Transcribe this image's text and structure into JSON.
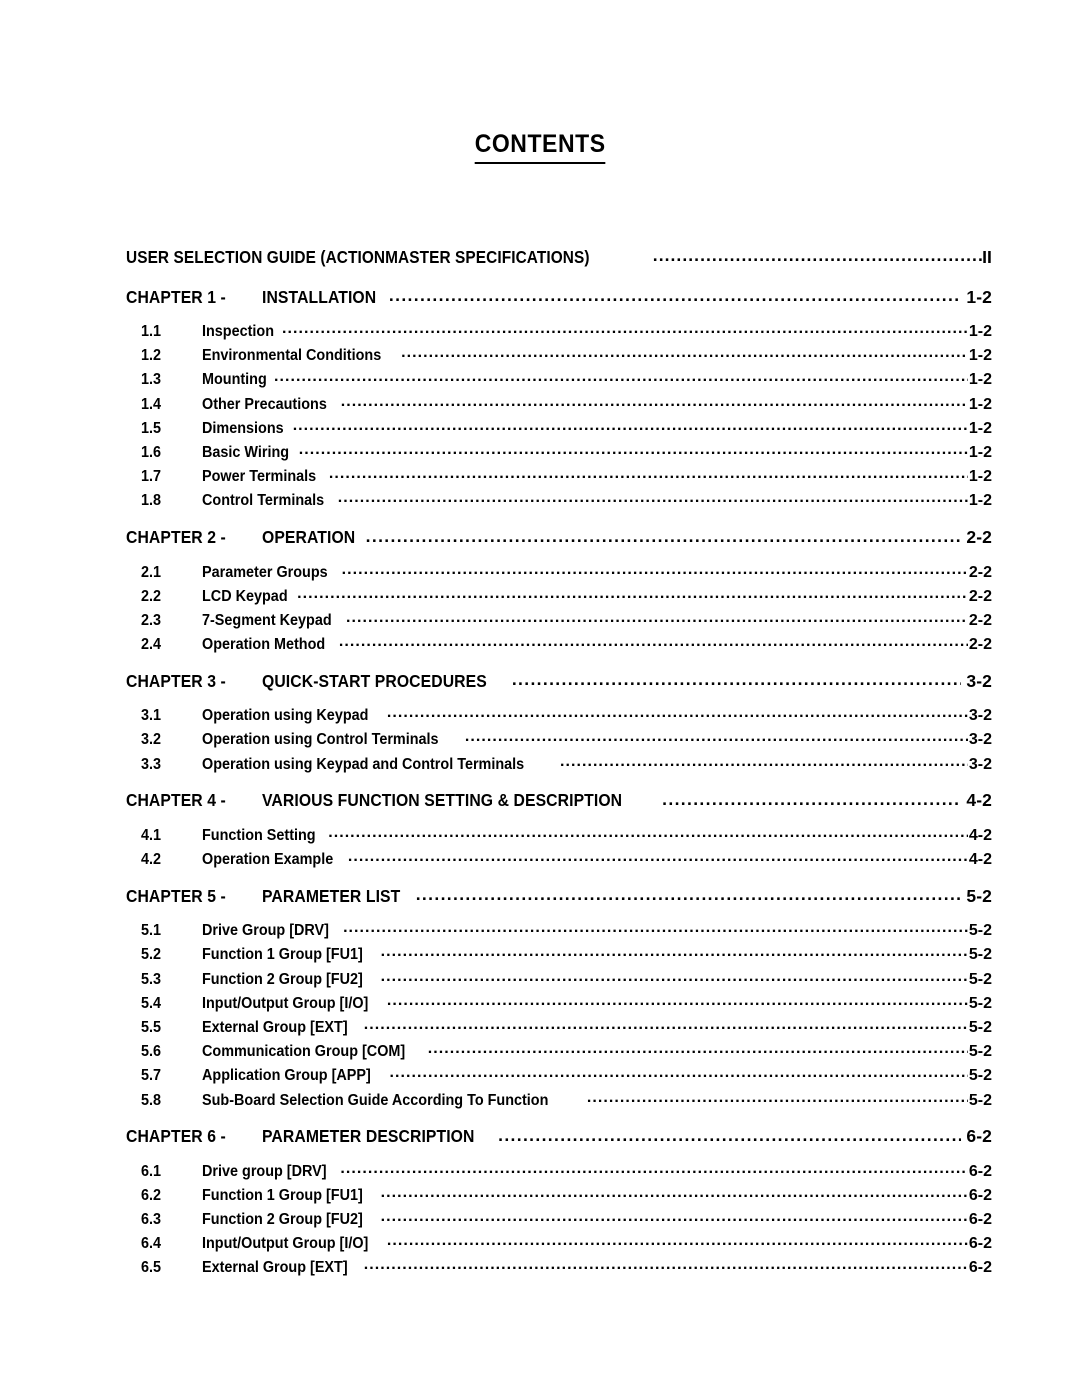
{
  "document": {
    "title": "CONTENTS"
  },
  "toc": {
    "entries": [
      {
        "kind": "top",
        "number": "",
        "label": "USER SELECTION GUIDE (ACTIONMASTER SPECIFICATIONS)",
        "page": "II"
      },
      {
        "kind": "chapter",
        "number": "CHAPTER 1 -",
        "label": "INSTALLATION",
        "page": "1-2"
      },
      {
        "kind": "sub",
        "number": "1.1",
        "label": "Inspection",
        "page": "1-2"
      },
      {
        "kind": "sub",
        "number": "1.2",
        "label": "Environmental Conditions",
        "page": "1-2"
      },
      {
        "kind": "sub",
        "number": "1.3",
        "label": "Mounting",
        "page": "1-2"
      },
      {
        "kind": "sub",
        "number": "1.4",
        "label": "Other Precautions",
        "page": "1-2"
      },
      {
        "kind": "sub",
        "number": "1.5",
        "label": "Dimensions",
        "page": "1-2"
      },
      {
        "kind": "sub",
        "number": "1.6",
        "label": "Basic Wiring",
        "page": "1-2"
      },
      {
        "kind": "sub",
        "number": "1.7",
        "label": "Power Terminals",
        "page": "1-2"
      },
      {
        "kind": "sub",
        "number": "1.8",
        "label": "Control Terminals",
        "page": "1-2"
      },
      {
        "kind": "chapter",
        "number": "CHAPTER 2 -",
        "label": "OPERATION",
        "page": "2-2"
      },
      {
        "kind": "sub",
        "number": "2.1",
        "label": "Parameter Groups",
        "page": "2-2"
      },
      {
        "kind": "sub",
        "number": "2.2",
        "label": "LCD Keypad",
        "page": "2-2"
      },
      {
        "kind": "sub",
        "number": "2.3",
        "label": "7-Segment Keypad",
        "page": "2-2"
      },
      {
        "kind": "sub",
        "number": "2.4",
        "label": "Operation Method",
        "page": "2-2"
      },
      {
        "kind": "chapter",
        "number": "CHAPTER 3 -",
        "label": "QUICK-START PROCEDURES",
        "page": "3-2"
      },
      {
        "kind": "sub",
        "number": "3.1",
        "label": "Operation using Keypad",
        "page": "3-2"
      },
      {
        "kind": "sub",
        "number": "3.2",
        "label": "Operation using Control Terminals",
        "page": "3-2"
      },
      {
        "kind": "sub",
        "number": "3.3",
        "label": "Operation using Keypad and Control Terminals",
        "page": "3-2"
      },
      {
        "kind": "chapter",
        "number": "CHAPTER 4 -",
        "label": "VARIOUS FUNCTION SETTING & DESCRIPTION",
        "page": "4-2"
      },
      {
        "kind": "sub",
        "number": "4.1",
        "label": "Function Setting",
        "page": "4-2"
      },
      {
        "kind": "sub",
        "number": "4.2",
        "label": "Operation Example",
        "page": "4-2"
      },
      {
        "kind": "chapter",
        "number": "CHAPTER 5 -",
        "label": "PARAMETER LIST",
        "page": "5-2"
      },
      {
        "kind": "sub",
        "number": "5.1",
        "label": "Drive Group [DRV]",
        "page": "5-2"
      },
      {
        "kind": "sub",
        "number": "5.2",
        "label": "Function 1 Group [FU1]",
        "page": "5-2"
      },
      {
        "kind": "sub",
        "number": "5.3",
        "label": "Function 2 Group [FU2]",
        "page": "5-2"
      },
      {
        "kind": "sub",
        "number": "5.4",
        "label": "Input/Output Group [I/O]",
        "page": "5-2"
      },
      {
        "kind": "sub",
        "number": "5.5",
        "label": "External Group [EXT]",
        "page": "5-2"
      },
      {
        "kind": "sub",
        "number": "5.6",
        "label": "Communication Group [COM]",
        "page": "5-2"
      },
      {
        "kind": "sub",
        "number": "5.7",
        "label": "Application Group [APP]",
        "page": "5-2"
      },
      {
        "kind": "sub",
        "number": "5.8",
        "label": "Sub-Board Selection Guide According To Function",
        "page": "5-2"
      },
      {
        "kind": "chapter",
        "number": "CHAPTER 6 -",
        "label": "PARAMETER DESCRIPTION",
        "page": "6-2"
      },
      {
        "kind": "sub",
        "number": "6.1",
        "label": "Drive group [DRV]",
        "page": "6-2"
      },
      {
        "kind": "sub",
        "number": "6.2",
        "label": "Function 1 Group [FU1]",
        "page": "6-2"
      },
      {
        "kind": "sub",
        "number": "6.3",
        "label": "Function 2 Group [FU2]",
        "page": "6-2"
      },
      {
        "kind": "sub",
        "number": "6.4",
        "label": "Input/Output Group [I/O]",
        "page": "6-2"
      },
      {
        "kind": "sub",
        "number": "6.5",
        "label": "External Group [EXT]",
        "page": "6-2"
      }
    ]
  },
  "colors": {
    "text": "#000000",
    "background": "#ffffff"
  }
}
